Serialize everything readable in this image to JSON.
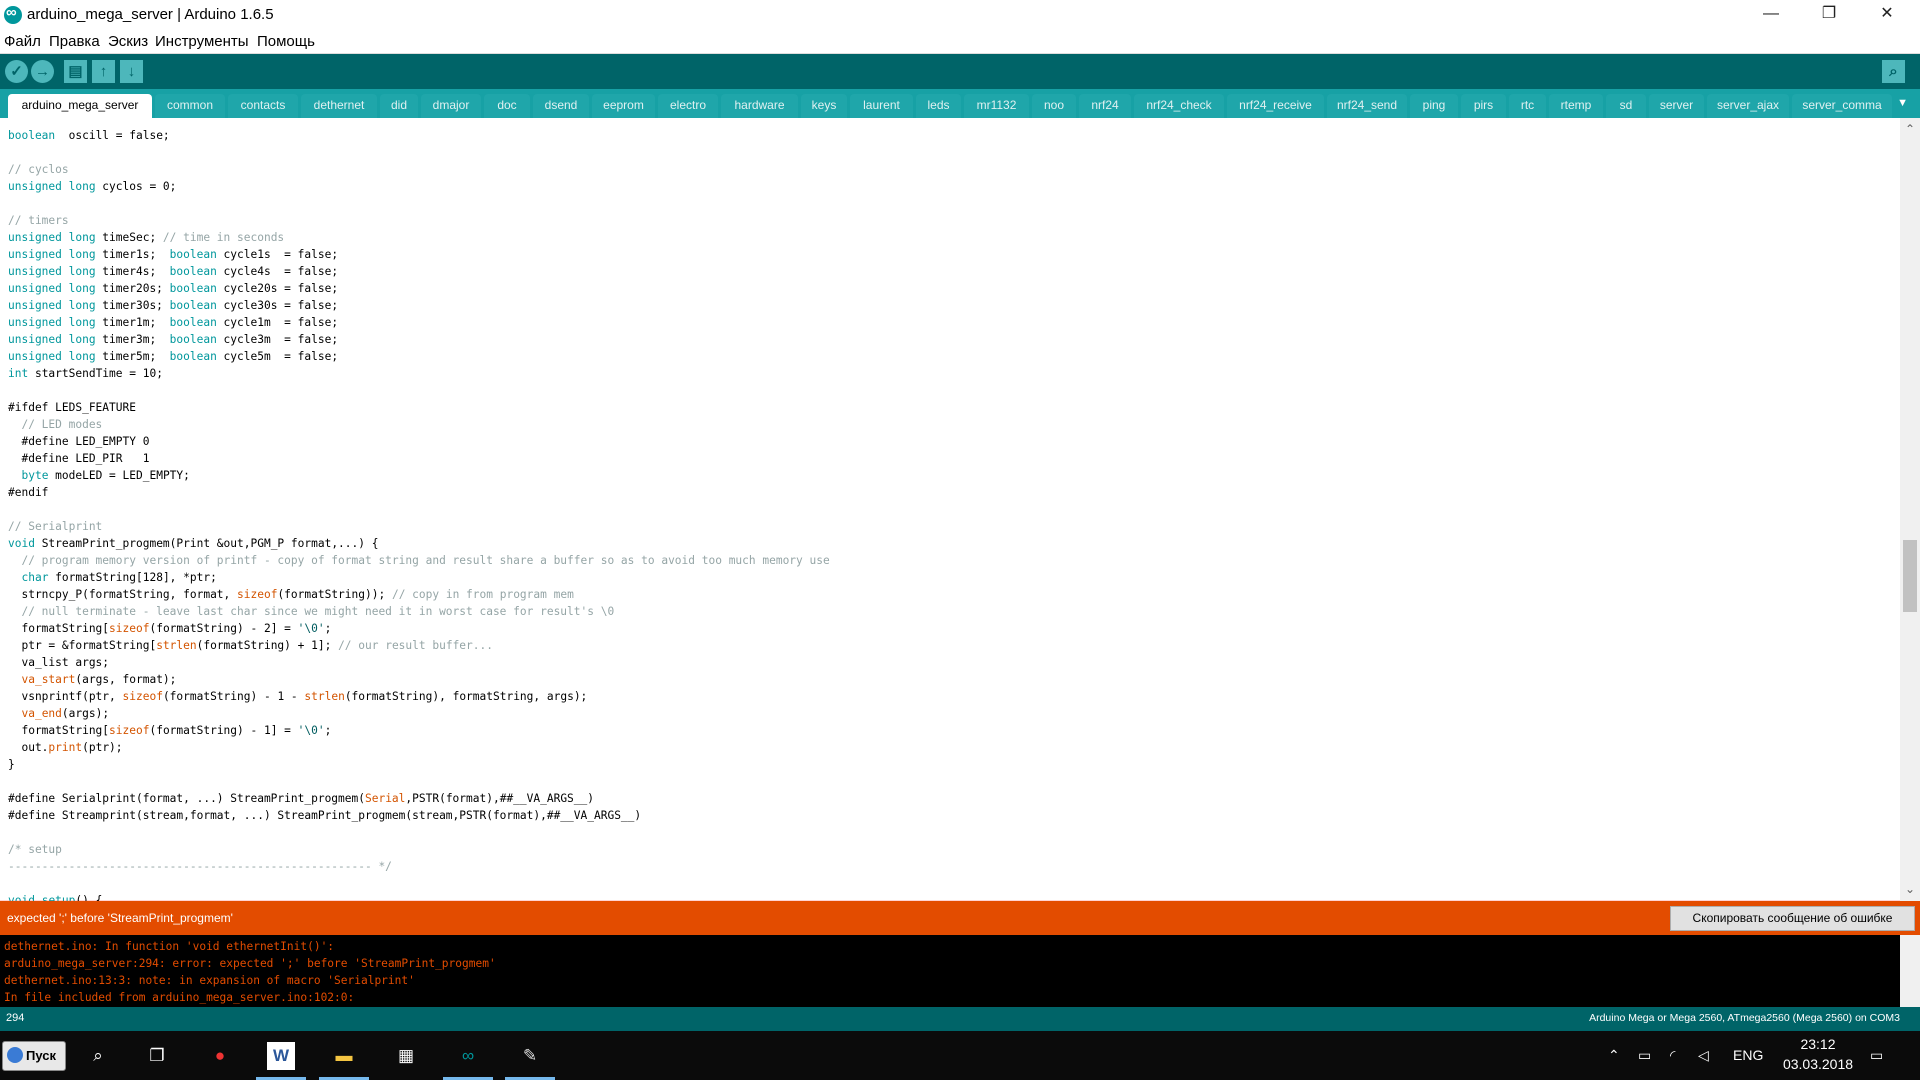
{
  "window": {
    "title": "arduino_mega_server | Arduino 1.6.5",
    "minimize": "—",
    "maximize": "❐",
    "close": "✕"
  },
  "menu": [
    "Файл",
    "Правка",
    "Эскиз",
    "Инструменты",
    "Помощь"
  ],
  "toolbar": {
    "verify": "✓",
    "upload": "→",
    "new": "▤",
    "open": "↑",
    "save": "↓",
    "serial_monitor": "⌕"
  },
  "tabs": [
    "arduino_mega_server",
    "common",
    "contacts",
    "dethernet",
    "did",
    "dmajor",
    "doc",
    "dsend",
    "eeprom",
    "electro",
    "hardware",
    "keys",
    "laurent",
    "leds",
    "mr1132",
    "noo",
    "nrf24",
    "nrf24_check",
    "nrf24_receive",
    "nrf24_send",
    "ping",
    "pirs",
    "rtc",
    "rtemp",
    "sd",
    "server",
    "server_ajax",
    "server_comma"
  ],
  "tab_menu": "▼",
  "code": [
    [
      [
        "kw",
        "boolean"
      ],
      [
        "",
        "  oscill = false;"
      ]
    ],
    [],
    [
      [
        "cm",
        "// cyclos"
      ]
    ],
    [
      [
        "kw",
        "unsigned long"
      ],
      [
        "",
        " cyclos = 0;"
      ]
    ],
    [],
    [
      [
        "cm",
        "// timers"
      ]
    ],
    [
      [
        "kw",
        "unsigned long"
      ],
      [
        "",
        " timeSec; "
      ],
      [
        "cm",
        "// time in seconds"
      ]
    ],
    [
      [
        "kw",
        "unsigned long"
      ],
      [
        "",
        " timer1s;  "
      ],
      [
        "kw",
        "boolean"
      ],
      [
        "",
        " cycle1s  = false;"
      ]
    ],
    [
      [
        "kw",
        "unsigned long"
      ],
      [
        "",
        " timer4s;  "
      ],
      [
        "kw",
        "boolean"
      ],
      [
        "",
        " cycle4s  = false;"
      ]
    ],
    [
      [
        "kw",
        "unsigned long"
      ],
      [
        "",
        " timer20s; "
      ],
      [
        "kw",
        "boolean"
      ],
      [
        "",
        " cycle20s = false;"
      ]
    ],
    [
      [
        "kw",
        "unsigned long"
      ],
      [
        "",
        " timer30s; "
      ],
      [
        "kw",
        "boolean"
      ],
      [
        "",
        " cycle30s = false;"
      ]
    ],
    [
      [
        "kw",
        "unsigned long"
      ],
      [
        "",
        " timer1m;  "
      ],
      [
        "kw",
        "boolean"
      ],
      [
        "",
        " cycle1m  = false;"
      ]
    ],
    [
      [
        "kw",
        "unsigned long"
      ],
      [
        "",
        " timer3m;  "
      ],
      [
        "kw",
        "boolean"
      ],
      [
        "",
        " cycle3m  = false;"
      ]
    ],
    [
      [
        "kw",
        "unsigned long"
      ],
      [
        "",
        " timer5m;  "
      ],
      [
        "kw",
        "boolean"
      ],
      [
        "",
        " cycle5m  = false;"
      ]
    ],
    [
      [
        "kw",
        "int"
      ],
      [
        "",
        " startSendTime = 10;"
      ]
    ],
    [],
    [
      [
        "",
        "#ifdef LEDS_FEATURE"
      ]
    ],
    [
      [
        "cm",
        "  // LED modes"
      ]
    ],
    [
      [
        "",
        "  #define LED_EMPTY 0"
      ]
    ],
    [
      [
        "",
        "  #define LED_PIR   1"
      ]
    ],
    [
      [
        "",
        "  "
      ],
      [
        "kw",
        "byte"
      ],
      [
        "",
        " modeLED = LED_EMPTY;"
      ]
    ],
    [
      [
        "",
        "#endif"
      ]
    ],
    [],
    [
      [
        "cm",
        "// Serialprint"
      ]
    ],
    [
      [
        "kw",
        "void"
      ],
      [
        "",
        " StreamPrint_progmem(Print &out,PGM_P format,...) {"
      ]
    ],
    [
      [
        "cm",
        "  // program memory version of printf - copy of format string and result share a buffer so as to avoid too much memory use"
      ]
    ],
    [
      [
        "",
        "  "
      ],
      [
        "kw",
        "char"
      ],
      [
        "",
        " formatString[128], *ptr;"
      ]
    ],
    [
      [
        "",
        "  strncpy_P(formatString, format, "
      ],
      [
        "fn",
        "sizeof"
      ],
      [
        "",
        "(formatString)); "
      ],
      [
        "cm",
        "// copy in from program mem"
      ]
    ],
    [
      [
        "cm",
        "  // null terminate - leave last char since we might need it in worst case for result's \\0"
      ]
    ],
    [
      [
        "",
        "  formatString["
      ],
      [
        "fn",
        "sizeof"
      ],
      [
        "",
        "(formatString) - 2] = "
      ],
      [
        "st",
        "'\\0'"
      ],
      [
        "",
        ";"
      ]
    ],
    [
      [
        "",
        "  ptr = &formatString["
      ],
      [
        "fn",
        "strlen"
      ],
      [
        "",
        "(formatString) + 1]; "
      ],
      [
        "cm",
        "// our result buffer..."
      ]
    ],
    [
      [
        "",
        "  va_list args;"
      ]
    ],
    [
      [
        "",
        "  "
      ],
      [
        "fn",
        "va_start"
      ],
      [
        "",
        "(args, format);"
      ]
    ],
    [
      [
        "",
        "  vsnprintf(ptr, "
      ],
      [
        "fn",
        "sizeof"
      ],
      [
        "",
        "(formatString) - 1 - "
      ],
      [
        "fn",
        "strlen"
      ],
      [
        "",
        "(formatString), formatString, args);"
      ]
    ],
    [
      [
        "",
        "  "
      ],
      [
        "fn",
        "va_end"
      ],
      [
        "",
        "(args);"
      ]
    ],
    [
      [
        "",
        "  formatString["
      ],
      [
        "fn",
        "sizeof"
      ],
      [
        "",
        "(formatString) - 1] = "
      ],
      [
        "st",
        "'\\0'"
      ],
      [
        "",
        ";"
      ]
    ],
    [
      [
        "",
        "  out."
      ],
      [
        "fn",
        "print"
      ],
      [
        "",
        "(ptr);"
      ]
    ],
    [
      [
        "",
        "}"
      ]
    ],
    [],
    [
      [
        "",
        "#define Serialprint(format, ...) StreamPrint_progmem("
      ],
      [
        "fn",
        "Serial"
      ],
      [
        "",
        ",PSTR(format),##__VA_ARGS__)"
      ]
    ],
    [
      [
        "",
        "#define Streamprint(stream,format, ...) StreamPrint_progmem(stream,PSTR(format),##__VA_ARGS__)"
      ]
    ],
    [],
    [
      [
        "cm",
        "/* setup"
      ]
    ],
    [
      [
        "cm",
        "------------------------------------------------------ */"
      ]
    ],
    [],
    [
      [
        "kw",
        "void"
      ],
      [
        "",
        " "
      ],
      [
        "kw",
        "setup"
      ],
      [
        "",
        "() {"
      ]
    ]
  ],
  "error_message": "expected ';' before 'StreamPrint_progmem'",
  "copy_button": "Скопировать сообщение об ошибке",
  "console": [
    "dethernet.ino: In function 'void ethernetInit()':",
    "arduino_mega_server:294: error: expected ';' before 'StreamPrint_progmem'",
    "dethernet.ino:13:3: note: in expansion of macro 'Serialprint'",
    "In file included from arduino_mega_server.ino:102:0:"
  ],
  "status": {
    "line": "294",
    "board": "Arduino Mega or Mega 2560, ATmega2560 (Mega 2560) on COM3"
  },
  "taskbar": {
    "start_label": "Пуск",
    "lang": "ENG",
    "time": "23:12",
    "date": "03.03.2018"
  },
  "colors": {
    "teal_dark": "#006468",
    "teal_tabs": "#17a1a5",
    "error_orange": "#e34c00",
    "highlight_pink": "#ffd3d3",
    "keyword": "#00979c",
    "function": "#d35400"
  }
}
